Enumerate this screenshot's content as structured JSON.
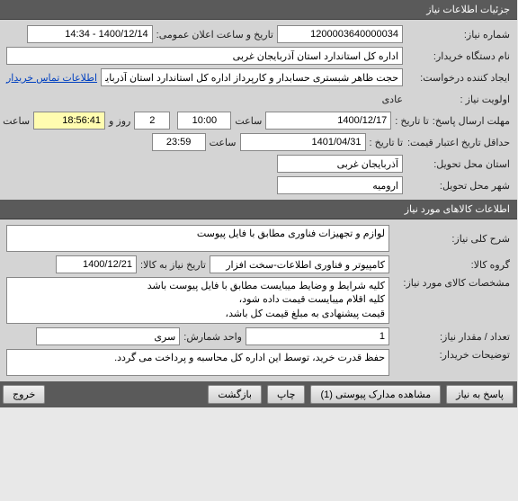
{
  "headers": {
    "need_info": "جزئیات اطلاعات نیاز",
    "goods_info": "اطلاعات کالاهای مورد نیاز"
  },
  "labels": {
    "need_no": "شماره نیاز:",
    "announce_date": "تاریخ و ساعت اعلان عمومی:",
    "buyer_org": "نام دستگاه خریدار:",
    "creator": "ایجاد کننده درخواست:",
    "priority": "اولویت نیاز :",
    "deadline": "مهلت ارسال پاسخ:",
    "to_date": "تا تاریخ :",
    "hour": "ساعت",
    "days_and": "روز و",
    "hours_left": "ساعت باقی مانده",
    "validity": "حداقل تاریخ اعتبار قیمت:",
    "delivery_province": "استان محل تحویل:",
    "delivery_city": "شهر محل تحویل:",
    "general_desc": "شرح کلی نیاز:",
    "goods_group": "گروه کالا:",
    "need_to_goods_date": "تاریخ نیاز به کالا:",
    "goods_spec": "مشخصات کالای مورد نیاز:",
    "qty": "تعداد / مقدار نیاز:",
    "unit": "واحد شمارش:",
    "buyer_notes": "توضیحات خریدار:",
    "contact": "اطلاعات تماس خریدار"
  },
  "values": {
    "need_no": "1200003640000034",
    "announce_date": "1400/12/14 - 14:34",
    "buyer_org": "اداره کل استاندارد استان آذربایجان غربی",
    "creator": "حجت ظاهر شبستری حسابدار و کارپرداز اداره کل استاندارد استان آذربایجان غربی",
    "priority": "عادی",
    "deadline_date": "1400/12/17",
    "deadline_time": "10:00",
    "days_left": "2",
    "time_left": "18:56:41",
    "validity_date": "1401/04/31",
    "validity_time": "23:59",
    "province": "آذربایجان غربی",
    "city": "ارومیه",
    "general_desc": "لوازم و تجهیزات فناوری مطابق با فایل پیوست",
    "goods_group": "کامپیوتر و فناوری اطلاعات-سخت افزار",
    "need_to_goods_date": "1400/12/21",
    "goods_spec": "کلیه شرایط و وضایط میبایست مطابق با فایل پیوست باشد\nکلیه اقلام میبایست قیمت داده شود،\nقیمت پیشنهادی به مبلغ قیمت کل باشد،",
    "qty": "1",
    "unit": "سری",
    "buyer_notes": "حفظ قدرت خرید، توسط این اداره کل محاسبه و پرداخت می گردد."
  },
  "buttons": {
    "respond": "پاسخ به نیاز",
    "attachments": "مشاهده مدارک پیوستی (1)",
    "print": "چاپ",
    "back": "بازگشت",
    "exit": "خروج"
  }
}
